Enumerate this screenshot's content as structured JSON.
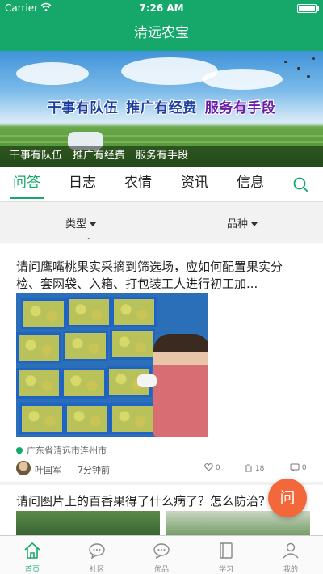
{
  "status_bar": {
    "carrier": "Carrier",
    "time": "7:26 AM"
  },
  "nav": {
    "title": "清远农宝"
  },
  "banner": {
    "slogan_1": "干事有队伍",
    "slogan_2": "推广有经费",
    "slogan_3": "服务有手段",
    "caption": "干事有队伍　推广有经费　服务有手段"
  },
  "tabs": [
    {
      "label": "问答",
      "active": true
    },
    {
      "label": "日志"
    },
    {
      "label": "农情"
    },
    {
      "label": "资讯"
    },
    {
      "label": "信息"
    }
  ],
  "filters": {
    "type_label": "类型",
    "variety_label": "品种"
  },
  "posts": [
    {
      "title": "请问鹰嘴桃果实采摘到筛选场，应如何配置果实分检、套网袋、入箱、打包装工人进行初工加...",
      "location": "广东省清远市连州市",
      "author": "叶国军",
      "time": "7分钟前",
      "likes": "0",
      "views": "18",
      "comments": "0"
    },
    {
      "title": "请问图片上的百香果得了什么病了？怎么防治？"
    }
  ],
  "fab": {
    "label": "问"
  },
  "tabbar": [
    {
      "label": "首页",
      "icon": "home-icon",
      "active": true
    },
    {
      "label": "社区",
      "icon": "chat-bubble-icon"
    },
    {
      "label": "优品",
      "icon": "chat-bubble-icon"
    },
    {
      "label": "学习",
      "icon": "book-icon"
    },
    {
      "label": "我的",
      "icon": "person-icon"
    }
  ],
  "colors": {
    "brand": "#16a76a",
    "fab": "#f3683a"
  }
}
